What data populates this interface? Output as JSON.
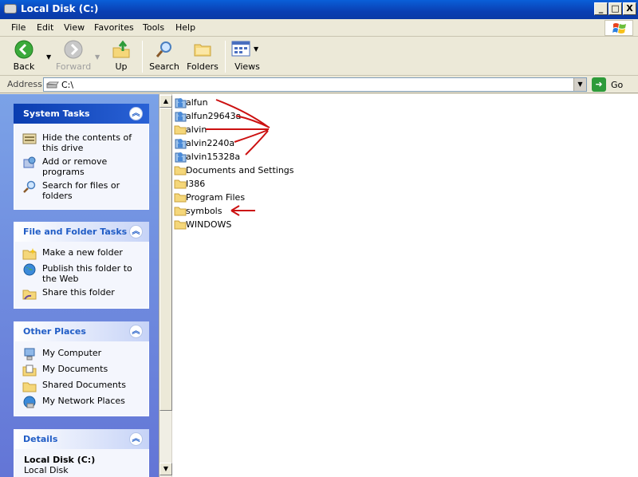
{
  "window": {
    "title": "Local Disk (C:)",
    "minimize": "_",
    "maximize": "□",
    "close": "X"
  },
  "menu": [
    "File",
    "Edit",
    "View",
    "Favorites",
    "Tools",
    "Help"
  ],
  "toolbar": {
    "back": "Back",
    "forward": "Forward",
    "up": "Up",
    "search": "Search",
    "folders": "Folders",
    "views": "Views"
  },
  "address": {
    "label": "Address",
    "value": "C:\\",
    "go": "Go"
  },
  "system_tasks": {
    "title": "System Tasks",
    "items": [
      {
        "label": "Hide the contents of this drive",
        "icon": "drive-hide-icon"
      },
      {
        "label": "Add or remove programs",
        "icon": "add-remove-programs-icon"
      },
      {
        "label": "Search for files or folders",
        "icon": "search-icon"
      }
    ]
  },
  "file_folder_tasks": {
    "title": "File and Folder Tasks",
    "items": [
      {
        "label": "Make a new folder",
        "icon": "new-folder-icon"
      },
      {
        "label": "Publish this folder to the Web",
        "icon": "publish-web-icon"
      },
      {
        "label": "Share this folder",
        "icon": "share-folder-icon"
      }
    ]
  },
  "other_places": {
    "title": "Other Places",
    "items": [
      {
        "label": "My Computer",
        "icon": "my-computer-icon"
      },
      {
        "label": "My Documents",
        "icon": "my-documents-icon"
      },
      {
        "label": "Shared Documents",
        "icon": "folder-icon"
      },
      {
        "label": "My Network Places",
        "icon": "network-places-icon"
      }
    ]
  },
  "details": {
    "title": "Details",
    "name": "Local Disk (C:)",
    "type": "Local Disk"
  },
  "files": [
    {
      "name": "alfun",
      "icon": "user-folder-icon"
    },
    {
      "name": "alfun29643a",
      "icon": "user-folder-icon"
    },
    {
      "name": "alvin",
      "icon": "folder-icon"
    },
    {
      "name": "alvin2240a",
      "icon": "user-folder-icon"
    },
    {
      "name": "alvin15328a",
      "icon": "user-folder-icon"
    },
    {
      "name": "Documents and Settings",
      "icon": "folder-icon"
    },
    {
      "name": "I386",
      "icon": "folder-icon"
    },
    {
      "name": "Program Files",
      "icon": "folder-icon"
    },
    {
      "name": "symbols",
      "icon": "folder-icon"
    },
    {
      "name": "WINDOWS",
      "icon": "folder-icon"
    }
  ],
  "colors": {
    "annotation": "#CC1111",
    "titlebar": "#0A3FB3",
    "taskpane": "#7BA2E7"
  }
}
